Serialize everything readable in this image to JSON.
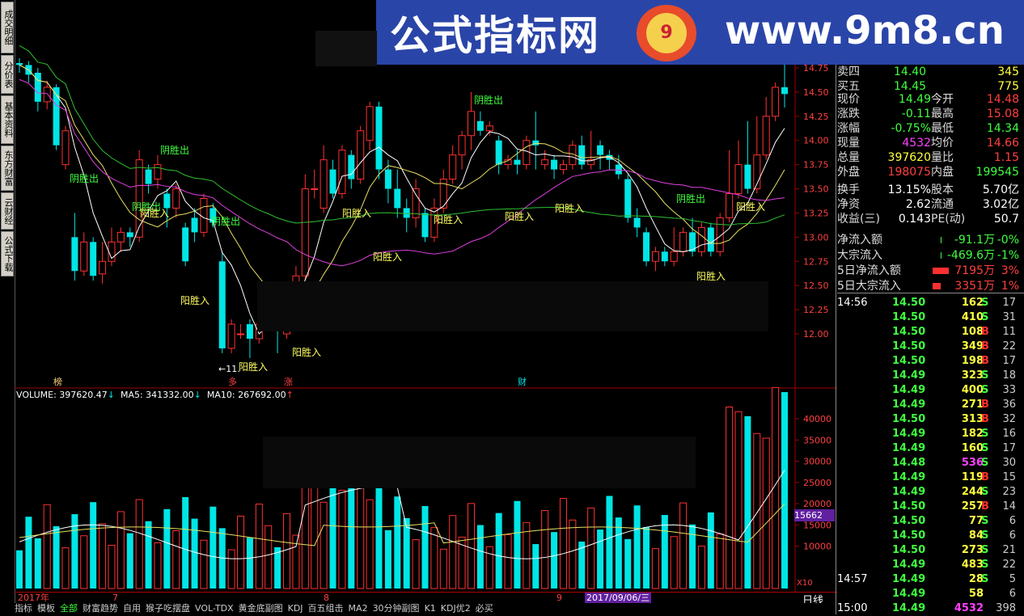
{
  "sidebar": {
    "tabs": [
      "成交明细",
      "分价表",
      "基本资料",
      "东方财富",
      "云财经",
      "公式下载"
    ]
  },
  "kline": {
    "price_axis": [
      "14.75",
      "14.50",
      "14.25",
      "14.00",
      "13.75",
      "13.50",
      "13.25",
      "13.00",
      "12.75",
      "12.50",
      "12.25",
      "12.00"
    ],
    "signals": [
      {
        "text": "阴胜出",
        "kind": "out"
      },
      {
        "text": "阴胜出",
        "kind": "out"
      },
      {
        "text": "阴胜出",
        "kind": "out"
      },
      {
        "text": "阴胜出",
        "kind": "out"
      },
      {
        "text": "阴胜出",
        "kind": "out"
      },
      {
        "text": "阴胜出",
        "kind": "out"
      },
      {
        "text": "阳胜入",
        "kind": "in"
      },
      {
        "text": "阳胜入",
        "kind": "in"
      },
      {
        "text": "阳胜入",
        "kind": "in"
      },
      {
        "text": "阳胜入",
        "kind": "in"
      },
      {
        "text": "阳胜入",
        "kind": "in"
      },
      {
        "text": "阳胜入",
        "kind": "in"
      },
      {
        "text": "阳胜入",
        "kind": "in"
      },
      {
        "text": "阳胜入",
        "kind": "in"
      },
      {
        "text": "阳胜入",
        "kind": "in"
      },
      {
        "text": "阳胜入",
        "kind": "in"
      },
      {
        "text": "阳胜入",
        "kind": "in"
      }
    ],
    "low_marker": "←11.",
    "event_tags": [
      "榜",
      "多",
      "涨",
      "财"
    ]
  },
  "volume": {
    "header_volume": "VOLUME: 397620.47",
    "header_ma5": "MA5: 341332.00",
    "header_ma10": "MA10: 267692.00",
    "axis": [
      "40000",
      "35000",
      "30000",
      "25000",
      "20000",
      "15000",
      "10000"
    ],
    "cursor_value": "15662",
    "unit": "X10"
  },
  "time_axis": {
    "year": "2017年",
    "m7": "7",
    "m8": "8",
    "m9": "9",
    "cursor_date": "2017/09/06/三",
    "period": "日线"
  },
  "bottom_tabs": [
    "指标",
    "模板",
    "全部",
    "财富趋势",
    "自用",
    "猴子吃摆盘",
    "VOL-TDX",
    "黄金底副图",
    "KDJ",
    "百五组击",
    "MA2",
    "30分钟副图",
    "K1",
    "KDJ优2",
    "必买"
  ],
  "quote": {
    "sell4": {
      "label": "卖四",
      "price": "14.40",
      "vol": "345"
    },
    "buy5": {
      "label": "买五",
      "price": "14.45",
      "vol": "775"
    },
    "rows": [
      {
        "l1": "现价",
        "v1": "14.49",
        "l2": "今开",
        "v2": "14.48"
      },
      {
        "l1": "涨跌",
        "v1": "-0.11",
        "l2": "最高",
        "v2": "15.08"
      },
      {
        "l1": "涨幅",
        "v1": "-0.75%",
        "l2": "最低",
        "v2": "14.34"
      },
      {
        "l1": "现量",
        "v1": "4532",
        "l2": "均价",
        "v2": "14.66"
      },
      {
        "l1": "总量",
        "v1": "397620",
        "l2": "量比",
        "v2": "1.15"
      },
      {
        "l1": "外盘",
        "v1": "198075",
        "l2": "内盘",
        "v2": "199545"
      },
      {
        "l1": "换手",
        "v1": "13.15%",
        "l2": "股本",
        "v2": "5.70亿"
      },
      {
        "l1": "净资",
        "v1": "2.62",
        "l2": "流通",
        "v2": "3.02亿"
      },
      {
        "l1": "收益(三)",
        "v1": "0.143",
        "l2": "PE(动)",
        "v2": "50.7"
      }
    ],
    "flows": [
      {
        "label": "净流入额",
        "value": "-91.1万",
        "pct": "-0%"
      },
      {
        "label": "大宗流入",
        "value": "-469.6万",
        "pct": "-1%"
      },
      {
        "label": "5日净流入额",
        "value": "7195万",
        "pct": "3%"
      },
      {
        "label": "5日大宗流入",
        "value": "3351万",
        "pct": "1%"
      }
    ]
  },
  "ticks": [
    {
      "time": "14:56",
      "price": "14.50",
      "vol": "162",
      "side": "S",
      "n": "17"
    },
    {
      "time": "",
      "price": "14.50",
      "vol": "410",
      "side": "S",
      "n": "31"
    },
    {
      "time": "",
      "price": "14.50",
      "vol": "108",
      "side": "B",
      "n": "11"
    },
    {
      "time": "",
      "price": "14.50",
      "vol": "349",
      "side": "B",
      "n": "22"
    },
    {
      "time": "",
      "price": "14.50",
      "vol": "198",
      "side": "B",
      "n": "17"
    },
    {
      "time": "",
      "price": "14.49",
      "vol": "323",
      "side": "S",
      "n": "18"
    },
    {
      "time": "",
      "price": "14.49",
      "vol": "400",
      "side": "S",
      "n": "33"
    },
    {
      "time": "",
      "price": "14.49",
      "vol": "271",
      "side": "B",
      "n": "36"
    },
    {
      "time": "",
      "price": "14.50",
      "vol": "313",
      "side": "B",
      "n": "32"
    },
    {
      "time": "",
      "price": "14.49",
      "vol": "182",
      "side": "S",
      "n": "16"
    },
    {
      "time": "",
      "price": "14.49",
      "vol": "160",
      "side": "S",
      "n": "17"
    },
    {
      "time": "",
      "price": "14.48",
      "vol": "536",
      "side": "S",
      "n": "30"
    },
    {
      "time": "",
      "price": "14.49",
      "vol": "119",
      "side": "B",
      "n": "15"
    },
    {
      "time": "",
      "price": "14.49",
      "vol": "244",
      "side": "S",
      "n": "23"
    },
    {
      "time": "",
      "price": "14.50",
      "vol": "257",
      "side": "B",
      "n": "14"
    },
    {
      "time": "",
      "price": "14.50",
      "vol": "77",
      "side": "S",
      "n": "6"
    },
    {
      "time": "",
      "price": "14.50",
      "vol": "84",
      "side": "S",
      "n": "6"
    },
    {
      "time": "",
      "price": "14.50",
      "vol": "273",
      "side": "S",
      "n": "21"
    },
    {
      "time": "",
      "price": "14.49",
      "vol": "483",
      "side": "S",
      "n": "22"
    },
    {
      "time": "14:57",
      "price": "14.49",
      "vol": "28",
      "side": "S",
      "n": "5"
    },
    {
      "time": "",
      "price": "14.49",
      "vol": "58",
      "side": "",
      "n": "6"
    },
    {
      "time": "15:00",
      "price": "14.49",
      "vol": "4532",
      "side": "",
      "n": "398"
    }
  ],
  "watermark": {
    "title": "公式指标网",
    "url": "www.9m8.cn",
    "badge": "9"
  },
  "colors": {
    "up": "#ff3030",
    "down": "#00e5e5",
    "ma_white": "#ffffff",
    "ma_yellow": "#e8e060",
    "ma_magenta": "#e040e0",
    "ma_green": "#30c030",
    "banner": "#2a45a8"
  }
}
